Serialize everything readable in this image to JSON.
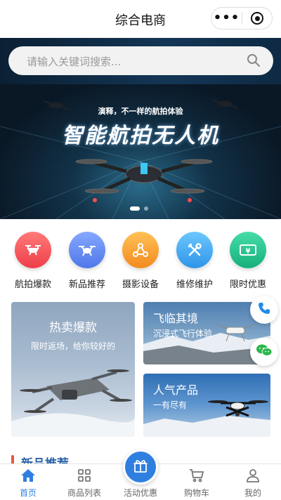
{
  "titlebar": {
    "title": "综合电商",
    "menu_icon": "more-dots-icon",
    "close_icon": "target-close-icon"
  },
  "search": {
    "placeholder": "请输入关键词搜索...",
    "icon": "search-icon"
  },
  "banner": {
    "subtitle": "演释，不一样的航拍体验",
    "title": "智能航拍无人机",
    "slides": 2,
    "active_slide": 0
  },
  "categories": [
    {
      "label": "航拍爆款",
      "icon": "drone-icon",
      "color": "#f0555a"
    },
    {
      "label": "新品推荐",
      "icon": "drone-icon",
      "color": "#5b86ef"
    },
    {
      "label": "摄影设备",
      "icon": "share-nodes-icon",
      "color": "#f6a13a"
    },
    {
      "label": "维修维护",
      "icon": "tools-icon",
      "color": "#3fa6ee"
    },
    {
      "label": "限时优惠",
      "icon": "coupon-icon",
      "color": "#27c08c"
    }
  ],
  "tiles": {
    "left": {
      "title": "热卖爆款",
      "subtitle": "限时返场，给你较好的"
    },
    "right_top": {
      "title": "飞临其境",
      "subtitle": "沉浸式飞行体验"
    },
    "right_bottom": {
      "title": "人气产品",
      "subtitle": "一有尽有"
    }
  },
  "floating": {
    "phone_icon": "phone-icon",
    "wechat_icon": "wechat-icon"
  },
  "section": {
    "title": "新品推荐"
  },
  "tabs": [
    {
      "label": "首页",
      "icon": "home-icon",
      "active": true
    },
    {
      "label": "商品列表",
      "icon": "grid-icon",
      "active": false
    },
    {
      "label": "活动优惠",
      "icon": "gift-icon",
      "active": false
    },
    {
      "label": "购物车",
      "icon": "cart-icon",
      "active": false
    },
    {
      "label": "我的",
      "icon": "user-icon",
      "active": false
    }
  ],
  "colors": {
    "accent": "#2f7fe0",
    "section_bar": "#e25b45"
  }
}
